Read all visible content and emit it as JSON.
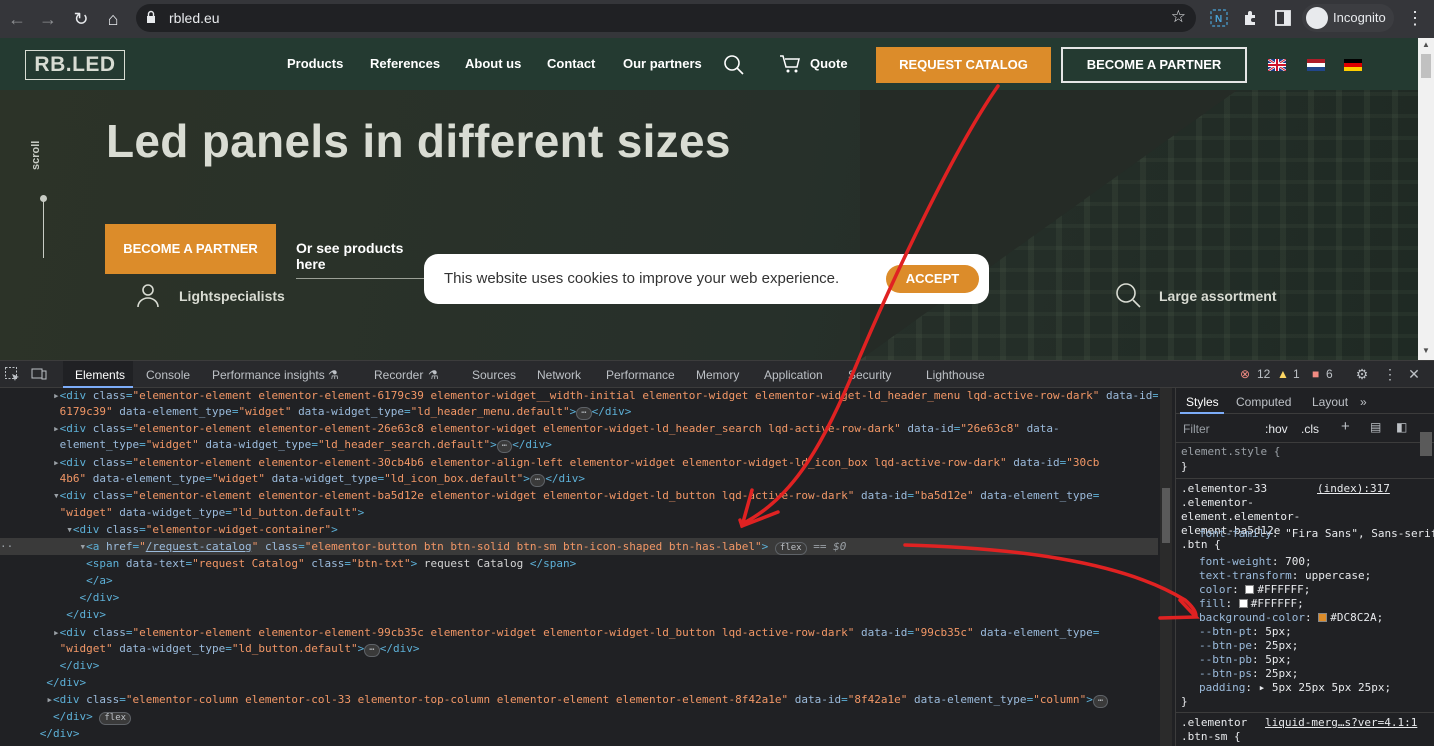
{
  "browser": {
    "url": "rbled.eu",
    "profile_label": "Incognito",
    "icons": [
      "back-icon",
      "forward-icon",
      "reload-icon",
      "home-icon",
      "lock-icon",
      "star-icon",
      "extension-icon",
      "puzzle-icon",
      "sidepanel-icon",
      "kebab-icon"
    ]
  },
  "site": {
    "logo": "RB.LED",
    "menu": [
      "Products",
      "References",
      "About us",
      "Contact",
      "Our partners"
    ],
    "quote_label": "Quote",
    "request_catalog": "REQUEST CATALOG",
    "become_partner_top": "BECOME A PARTNER",
    "scroll_label": "scroll",
    "hero_title": "Led panels in different sizes",
    "become_partner_hero": "BECOME A PARTNER",
    "see_products": "Or see products here",
    "features": [
      "Lightspecialists",
      "Large assortment"
    ],
    "cookie_message": "This website uses cookies to improve your web experience.",
    "cookie_accept": "ACCEPT",
    "colors": {
      "accent": "#DC8C2A",
      "header_bg": "#243A31"
    }
  },
  "devtools": {
    "tabs": [
      "Elements",
      "Console",
      "Performance insights",
      "Recorder",
      "Sources",
      "Network",
      "Performance",
      "Memory",
      "Application",
      "Security",
      "Lighthouse"
    ],
    "active_tab": "Elements",
    "errors": "12",
    "warnings": "1",
    "issues": "6",
    "styles_tabs": [
      "Styles",
      "Computed",
      "Layout"
    ],
    "filter_placeholder": "Filter",
    "hov": ":hov",
    "cls": ".cls",
    "dom_lines": [
      {
        "tag": "div",
        "class": "elementor-element elementor-element-6179c39 elementor-widget__width-initial elementor-widget elementor-widget-ld_header_menu lqd-active-row-dark",
        "id": "6179c39",
        "type": "widget",
        "widget": "ld_header_menu.default"
      },
      {
        "tag": "div",
        "class": "elementor-element elementor-element-26e63c8 elementor-widget elementor-widget-ld_header_search lqd-active-row-dark",
        "id": "26e63c8",
        "type": "widget",
        "widget": "ld_header_search.default"
      },
      {
        "tag": "div",
        "class": "elementor-element elementor-element-30cb4b6 elementor-align-left elementor-widget elementor-widget-ld_icon_box lqd-active-row-dark",
        "id": "30cb4b6",
        "type": "widget",
        "widget": "ld_icon_box.default"
      },
      {
        "tag": "div",
        "class": "elementor-element elementor-element-ba5d12e elementor-widget elementor-widget-ld_button lqd-active-row-dark",
        "id": "ba5d12e",
        "type": "widget",
        "widget": "ld_button.default"
      }
    ],
    "container_class": "elementor-widget-container",
    "anchor_href": "/request-catalog",
    "anchor_class": "elementor-button btn btn-solid btn-sm btn-icon-shaped btn-has-label",
    "flex_badge": "flex",
    "dollar": "== $0",
    "span_data_text": "request Catalog",
    "span_class": "btn-txt",
    "span_text": " request Catalog ",
    "second_widget": {
      "class": "elementor-element elementor-element-99cb35c elementor-widget elementor-widget-ld_button lqd-active-row-dark",
      "id": "99cb35c",
      "type": "widget",
      "widget": "ld_button.default"
    },
    "column": {
      "class": "elementor-column elementor-col-33 elementor-top-column elementor-element elementor-element-8f42a1e",
      "id": "8f42a1e",
      "type": "column"
    },
    "styles": {
      "element_style": "element.style {",
      "rule1_selector": ".elementor-33 .elementor-element.elementor-element-ba5d12e .btn {",
      "rule1_source": "(index):317",
      "props": [
        {
          "name": "font-family",
          "value": "\"Fira Sans\", Sans-serif;"
        },
        {
          "name": "font-weight",
          "value": "700;"
        },
        {
          "name": "text-transform",
          "value": "uppercase;"
        },
        {
          "name": "color",
          "value": "#FFFFFF;",
          "swatch": "#FFFFFF"
        },
        {
          "name": "fill",
          "value": "#FFFFFF;",
          "swatch": "#FFFFFF"
        },
        {
          "name": "background-color",
          "value": "#DC8C2A;",
          "swatch": "#DC8C2A"
        },
        {
          "name": "--btn-pt",
          "value": "5px;"
        },
        {
          "name": "--btn-pe",
          "value": "25px;"
        },
        {
          "name": "--btn-pb",
          "value": "5px;"
        },
        {
          "name": "--btn-ps",
          "value": "25px;"
        },
        {
          "name": "padding",
          "value": "▸ 5px 25px 5px 25px;"
        }
      ],
      "rule2_selector": ".elementor .btn-sm {",
      "rule2_source": "liquid-merg…s?ver=4.1:1"
    }
  }
}
